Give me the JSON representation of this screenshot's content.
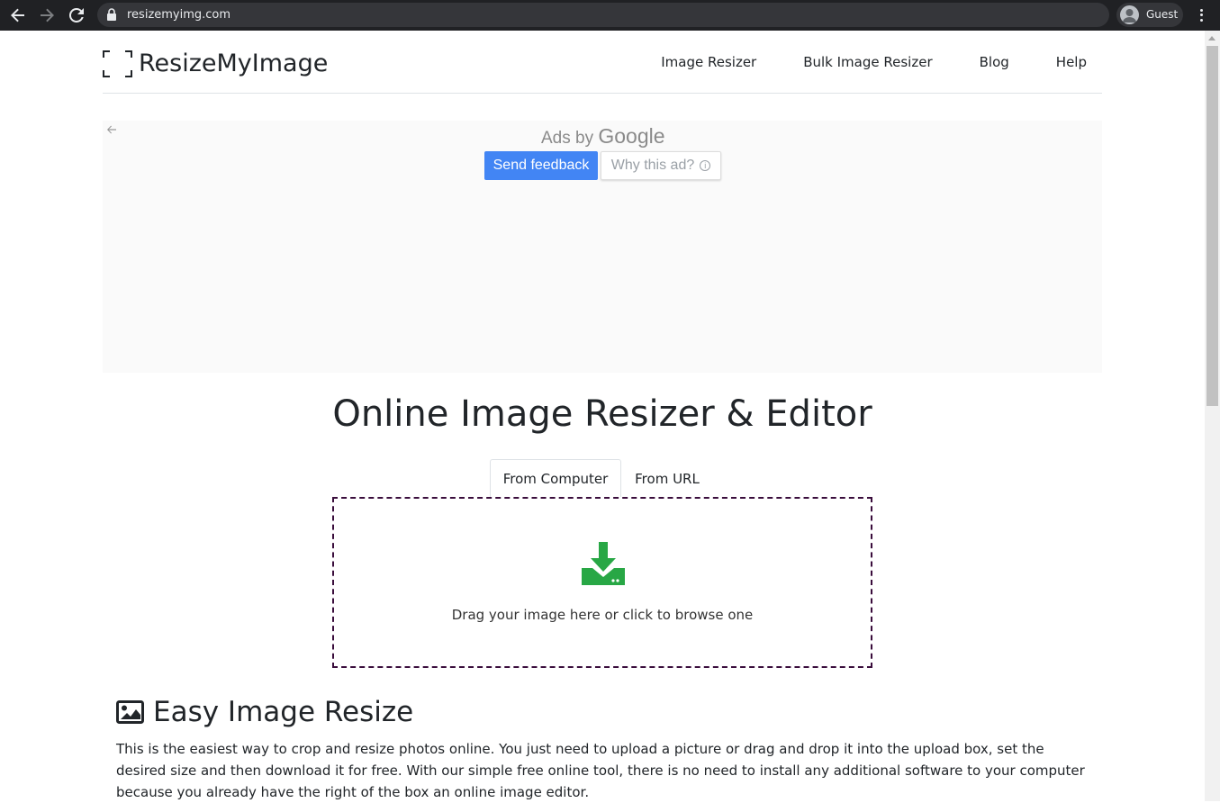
{
  "browser": {
    "url": "resizemyimg.com",
    "profile_label": "Guest"
  },
  "site": {
    "logo_text": "ResizeMyImage",
    "nav": [
      "Image Resizer",
      "Bulk Image Resizer",
      "Blog",
      "Help"
    ]
  },
  "ad": {
    "ads_by": "Ads by",
    "google": "Google",
    "send_feedback": "Send feedback",
    "why_this_ad": "Why this ad?"
  },
  "main": {
    "title": "Online Image Resizer & Editor",
    "tabs": [
      "From Computer",
      "From URL"
    ],
    "dropzone_hint": "Drag your image here or click to browse one"
  },
  "section": {
    "title": "Easy Image Resize",
    "body": "This is the easiest way to crop and resize photos online. You just need to upload a picture or drag and drop it into the upload box, set the desired size and then download it for free. With our simple free online tool, there is no need to install any additional software to your computer because you already have the right of the box an online image editor."
  },
  "colors": {
    "accent_green": "#28a745",
    "google_blue": "#4285f4",
    "dropzone_border": "#3a0d3c"
  }
}
